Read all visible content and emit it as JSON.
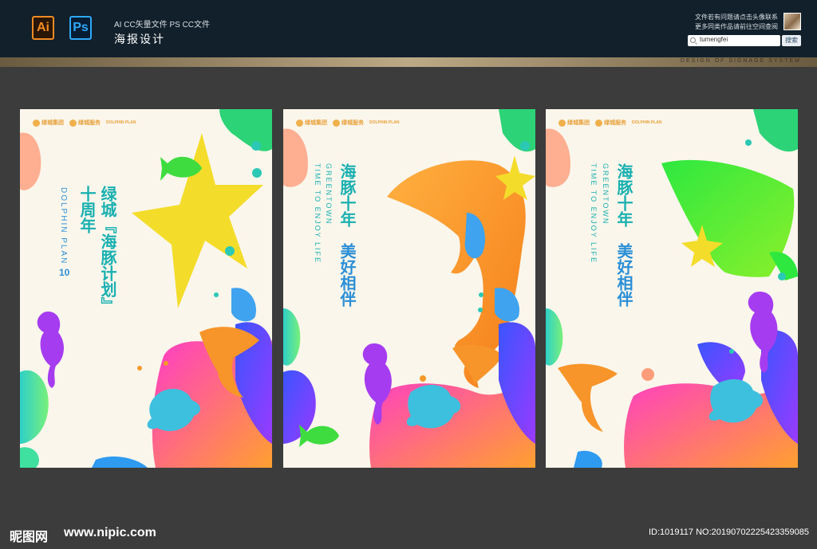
{
  "header": {
    "app_icons": [
      {
        "label": "Ai",
        "icon": "illustrator-icon",
        "color": "#f08a24"
      },
      {
        "label": "Ps",
        "icon": "photoshop-icon",
        "color": "#30a8f8"
      }
    ],
    "formats": "AI CC矢量文件   PS CC文件",
    "title": "海报设计",
    "note_line1": "文件若有问题请点击头像联系",
    "note_line2": "更多同类作品请前往空间查阅",
    "search": {
      "value": "tumengfei",
      "button": "搜索"
    },
    "banner_caption": "DESIGN OF SIGNAGE SYSTEM"
  },
  "posters": [
    {
      "logos": {
        "brand1": "绿城集团",
        "brand2": "绿城服务",
        "brand3": "DOLPHIN PLAN"
      },
      "headline_col1": "绿城『海豚计划』",
      "headline_col2": "十周年",
      "subtitle": "DOLPHIN PLAN",
      "badge": "10"
    },
    {
      "logos": {
        "brand1": "绿城集团",
        "brand2": "绿城服务",
        "brand3": "DOLPHIN PLAN"
      },
      "headline_col1": "海豚十年",
      "headline_col2": "美好相伴",
      "subtitle_col1": "GREENTOWN",
      "subtitle_col2": "TIME TO ENJOY LIFE"
    },
    {
      "logos": {
        "brand1": "绿城集团",
        "brand2": "绿城服务",
        "brand3": "DOLPHIN PLAN"
      },
      "headline_col1": "海豚十年",
      "headline_col2": "美好相伴",
      "subtitle_col1": "GREENTOWN",
      "subtitle_col2": "TIME TO ENJOY LIFE"
    }
  ],
  "footer": {
    "site_name": "昵图网",
    "url": "www.nipic.com",
    "id_text": "ID:1019117 NO:20190702225423359085"
  },
  "colors": {
    "header_bg": "#12202b",
    "page_bg": "#3c3c3c",
    "poster_bg": "#fbf6ec",
    "headline_teal": "#18b0b0",
    "headline_blue": "#2a8fd6",
    "accent_orange": "#f59a2a",
    "accent_yellow": "#f4dc2a"
  }
}
